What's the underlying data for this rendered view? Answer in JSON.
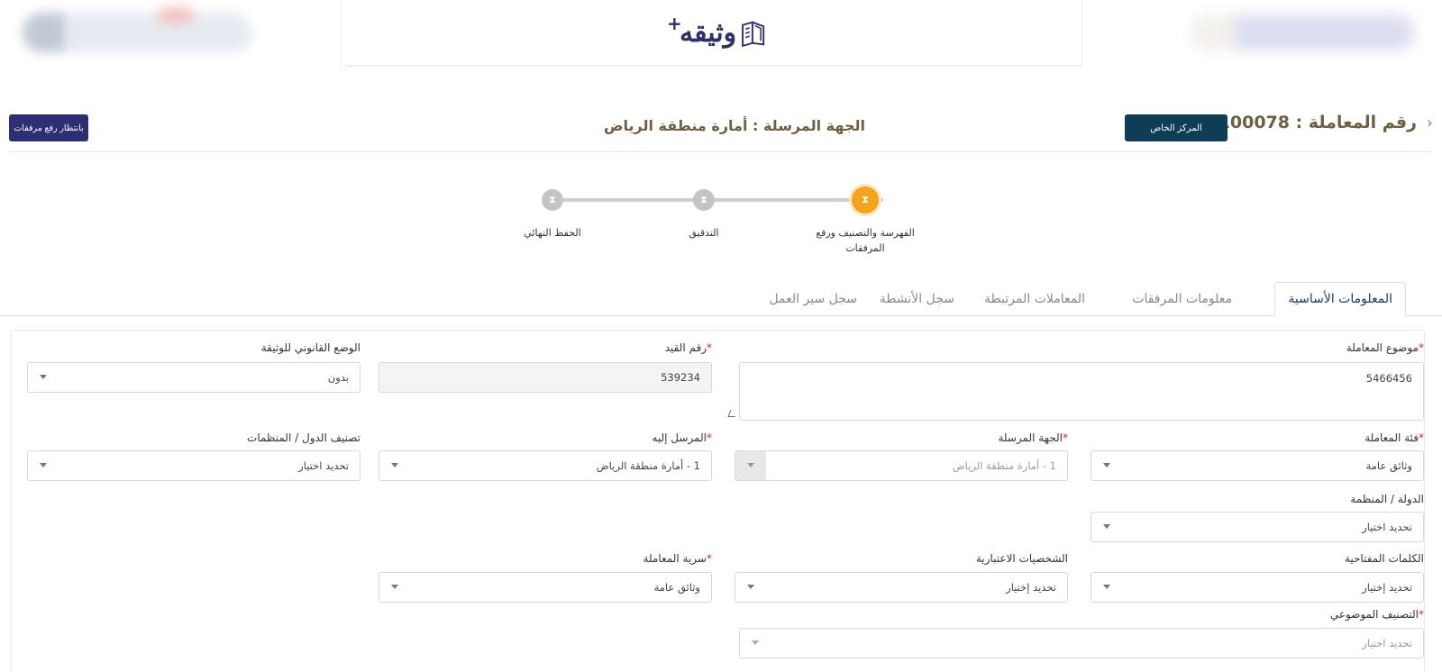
{
  "header": {
    "logo_text": "وثيقه",
    "logo_plus": "+"
  },
  "title_row": {
    "transaction_number": "رقم المعاملة : 1/1100078",
    "center_button": "المركز الخاص",
    "sender_title": "الجهة المرسلة : أمارة منطقة الرياض",
    "waiting_button": "بانتظار رفع مرفقات"
  },
  "stepper": {
    "steps": [
      {
        "label": "الفهرسة والتصنيف ورفع المرفقات",
        "state": "active"
      },
      {
        "label": "التدقيق",
        "state": "pending"
      },
      {
        "label": "الحفظ النهائي",
        "state": "pending"
      }
    ]
  },
  "tabs": [
    {
      "label": "المعلومات الأساسية",
      "active": true
    },
    {
      "label": "معلومات المرفقات",
      "active": false
    },
    {
      "label": "المعاملات المرتبطة",
      "active": false
    },
    {
      "label": "سجل الأنشطة",
      "active": false
    },
    {
      "label": "سجل سير العمل",
      "active": false
    }
  ],
  "form": {
    "subject": {
      "label": "موضوع المعاملة",
      "value": "5466456"
    },
    "record_number": {
      "label": "رقم القيد",
      "value": "539234"
    },
    "legal_status": {
      "label": "الوضع القانوني للوثيقة",
      "value": "بدون"
    },
    "category": {
      "label": "فئة المعاملة",
      "value": "وثائق عامة"
    },
    "sender": {
      "label": "الجهة المرسلة",
      "value": "1 - أمارة منطقة الرياض"
    },
    "recipient": {
      "label": "المرسل إليه",
      "value": "1 - أمارة منطقة الرياض"
    },
    "countries_classification": {
      "label": "تصنيف الدول / المنظمات",
      "value": "تحديد اختيار"
    },
    "country": {
      "label": "الدولة / المنظمة",
      "value": "تحديد اختيار"
    },
    "keywords": {
      "label": "الكلمات المفتاحية",
      "value": "تحديد إختيار"
    },
    "legal_persons": {
      "label": "الشخصيات الاعتبارية",
      "value": "تحديد إختيار"
    },
    "confidentiality": {
      "label": "سرية المعاملة",
      "value": "وثائق عامة"
    },
    "topic_classification": {
      "label": "التصنيف الموضوعي",
      "value": "تحديد اختيار"
    },
    "required_mark": "*"
  },
  "colors": {
    "primary_navy": "#2d2e73",
    "teal_button": "#0f3d56",
    "active_step": "#f4a41c",
    "title_text": "#6e5f40",
    "required": "#d0252c"
  }
}
